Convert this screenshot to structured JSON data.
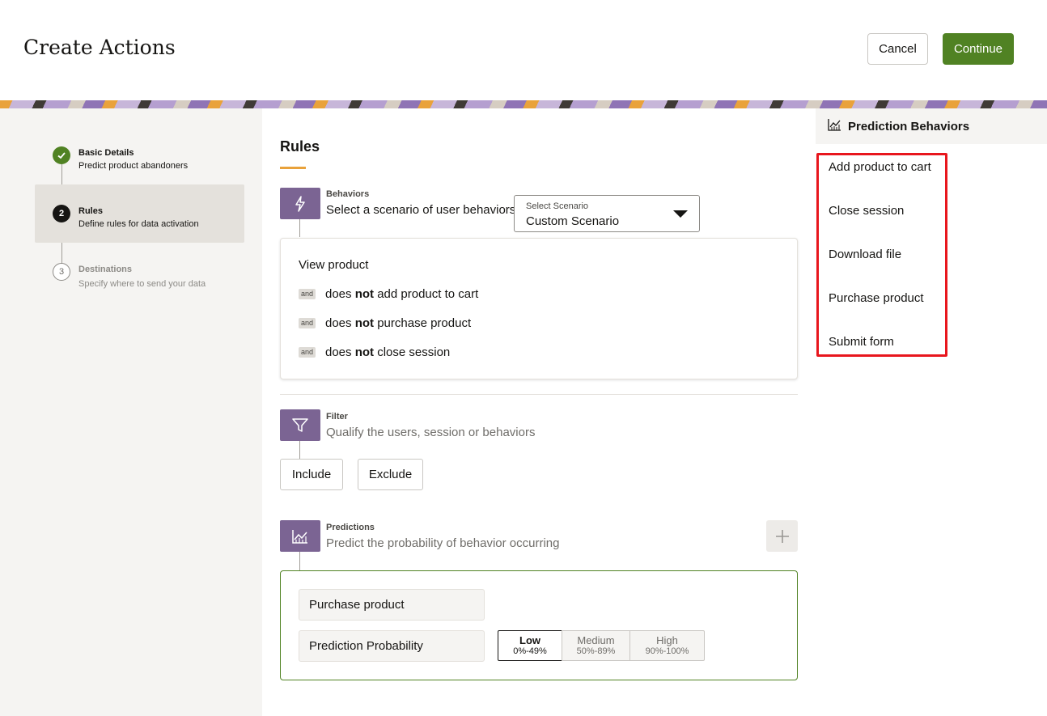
{
  "header": {
    "title": "Create Actions",
    "cancel_label": "Cancel",
    "continue_label": "Continue"
  },
  "steps": [
    {
      "number": "1",
      "title": "Basic Details",
      "description": "Predict product abandoners",
      "state": "done"
    },
    {
      "number": "2",
      "title": "Rules",
      "description": "Define rules for data activation",
      "state": "current"
    },
    {
      "number": "3",
      "title": "Destinations",
      "description": "Specify where to send your data",
      "state": "future"
    }
  ],
  "main": {
    "section_title": "Rules",
    "behaviors": {
      "eyebrow": "Behaviors",
      "subtitle": "Select a scenario of user behaviors",
      "icon": "lightning-icon",
      "select": {
        "label": "Select Scenario",
        "value": "Custom Scenario"
      },
      "scenario": {
        "first": "View product",
        "and_badge": "and",
        "conditions": [
          {
            "prefix": "does",
            "emphasis": "not",
            "suffix": "add product to cart"
          },
          {
            "prefix": "does",
            "emphasis": "not",
            "suffix": "purchase product"
          },
          {
            "prefix": "does",
            "emphasis": "not",
            "suffix": "close session"
          }
        ]
      }
    },
    "filter": {
      "eyebrow": "Filter",
      "subtitle": "Qualify the users, session or behaviors",
      "icon": "funnel-icon",
      "include_label": "Include",
      "exclude_label": "Exclude"
    },
    "predictions": {
      "eyebrow": "Predictions",
      "subtitle": "Predict the probability of behavior occurring",
      "icon": "chart-icon",
      "add_icon": "plus-icon",
      "behavior_field": "Purchase product",
      "probability_field": "Prediction Probability",
      "levels": [
        {
          "name": "Low",
          "range": "0%-49%",
          "selected": true
        },
        {
          "name": "Medium",
          "range": "50%-89%",
          "selected": false
        },
        {
          "name": "High",
          "range": "90%-100%",
          "selected": false
        }
      ]
    }
  },
  "right_panel": {
    "title": "Prediction Behaviors",
    "icon": "chart-icon",
    "behaviors": [
      "Add product to cart",
      "Close session",
      "Download file",
      "Purchase product",
      "Submit form"
    ]
  },
  "colors": {
    "brand_green": "#508223",
    "accent_purple": "#7b6493",
    "underline_orange": "#e9a23b",
    "highlight_red": "#e8161d"
  }
}
